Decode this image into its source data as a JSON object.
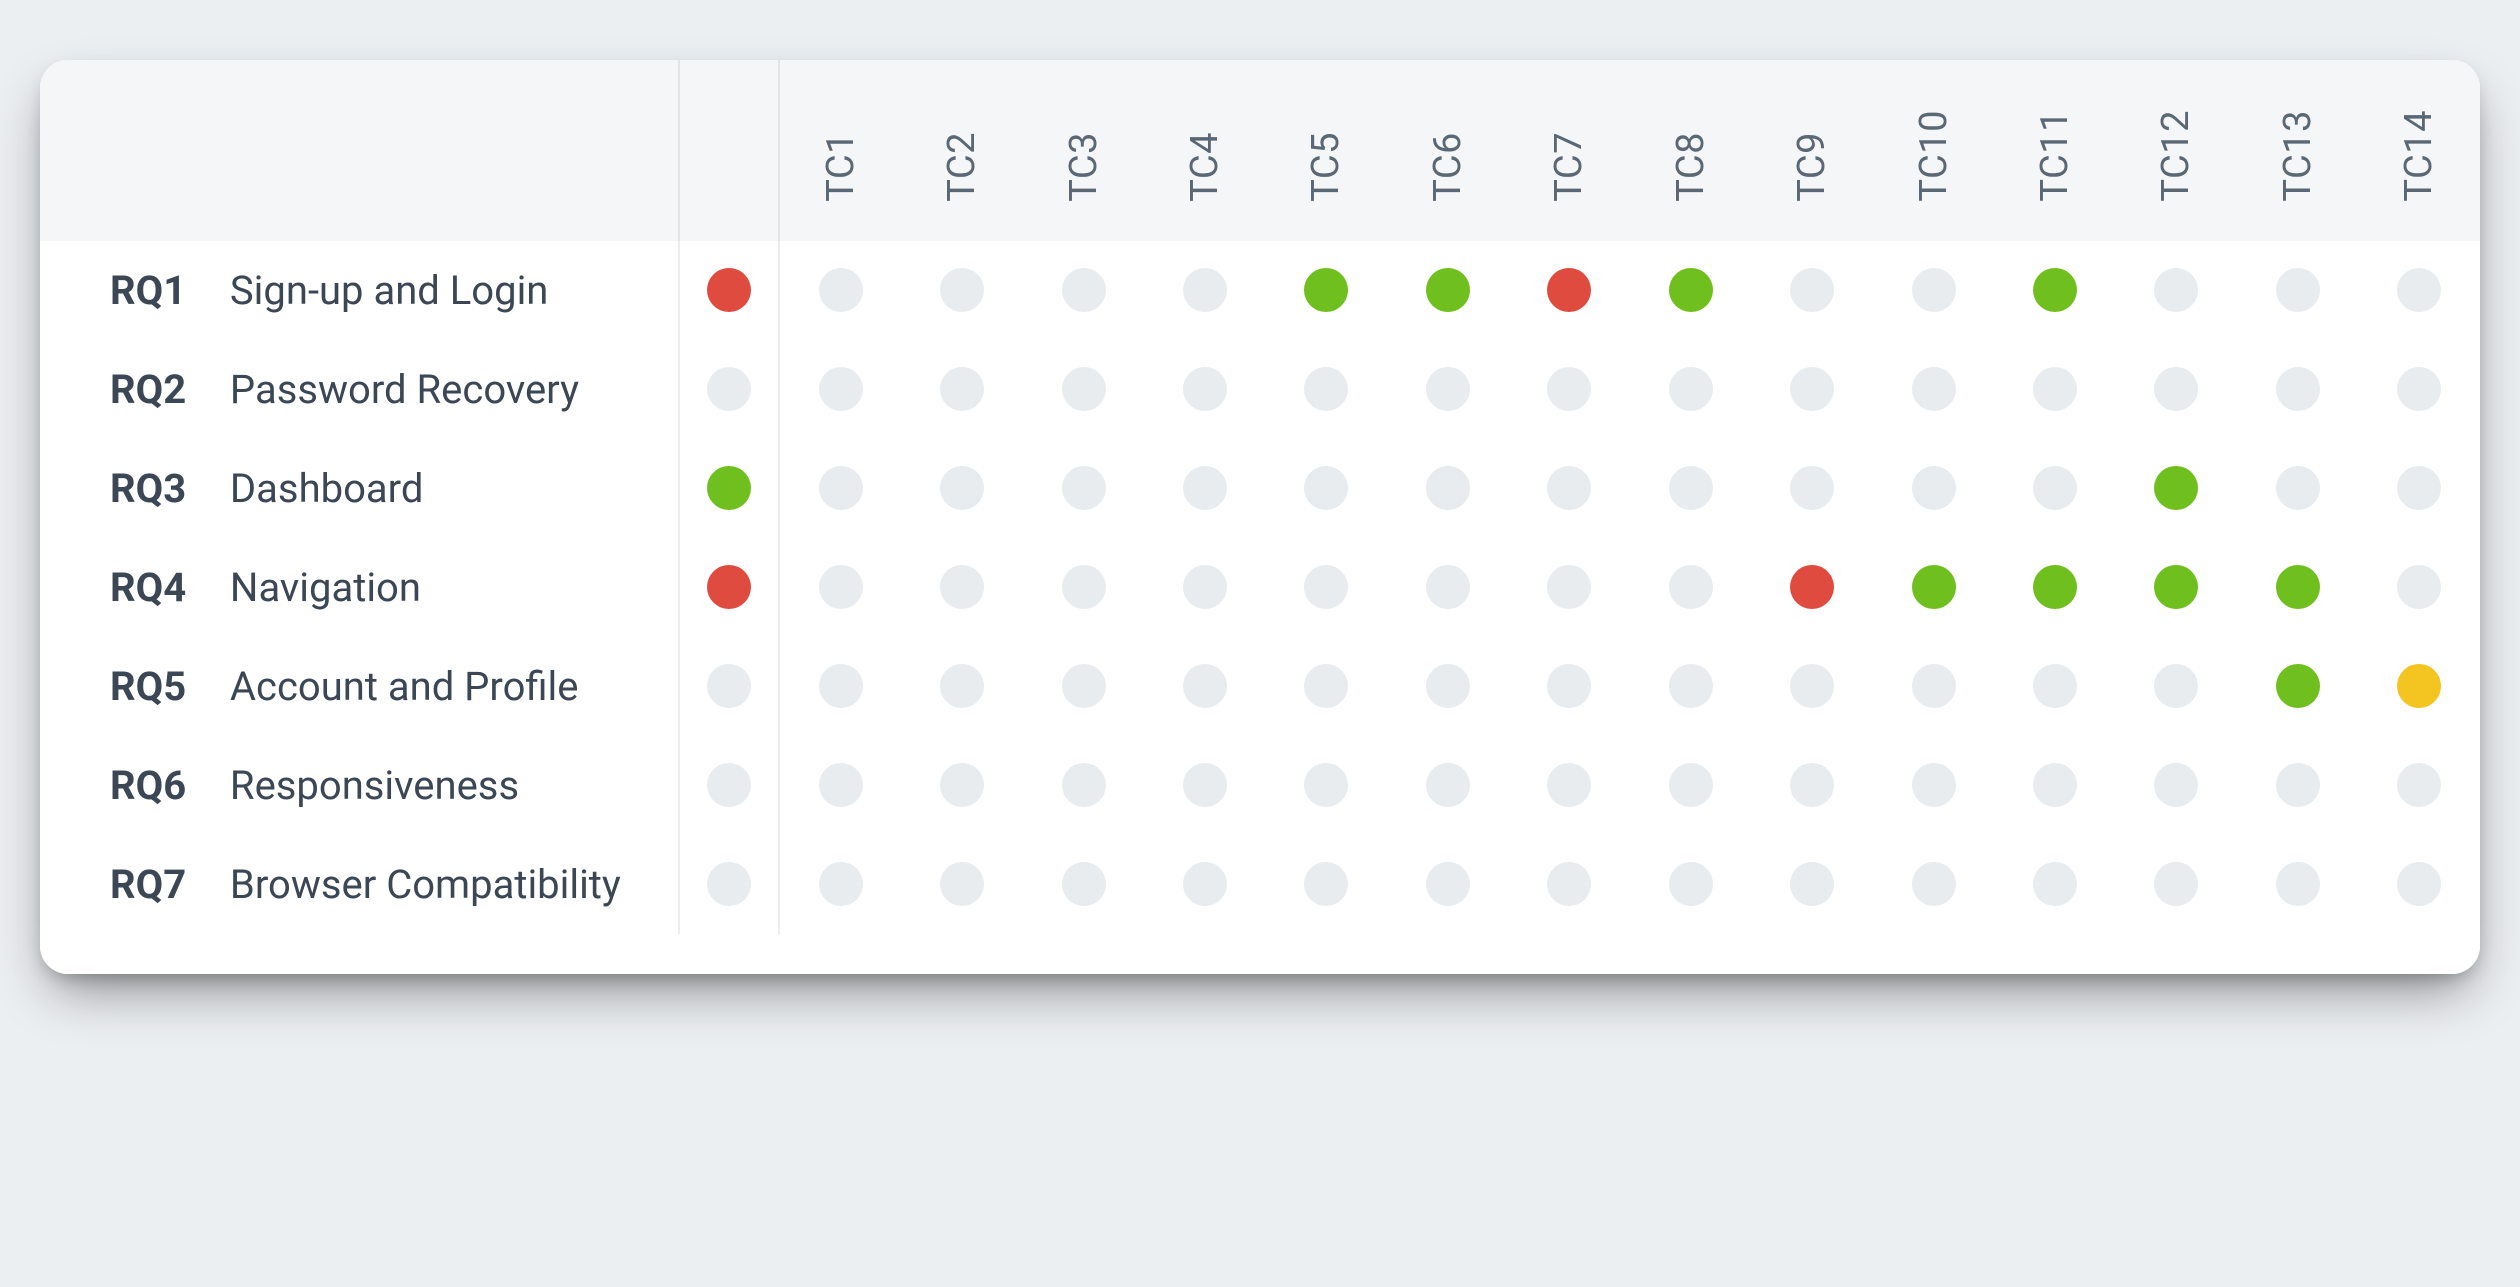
{
  "colors": {
    "green": "#6fbf1e",
    "red": "#e04b3f",
    "yellow": "#f4c420",
    "empty": "#e8ecef"
  },
  "testcases": [
    "TC1",
    "TC2",
    "TC3",
    "TC4",
    "TC5",
    "TC6",
    "TC7",
    "TC8",
    "TC9",
    "TC10",
    "TC11",
    "TC12",
    "TC13",
    "TC14"
  ],
  "requirements": [
    {
      "id": "RQ1",
      "name": "Sign-up and Login",
      "status": "red",
      "cells": [
        "",
        "",
        "",
        "",
        "green",
        "green",
        "red",
        "green",
        "",
        "",
        "green",
        "",
        "",
        ""
      ]
    },
    {
      "id": "RQ2",
      "name": "Password Recovery",
      "status": "",
      "cells": [
        "",
        "",
        "",
        "",
        "",
        "",
        "",
        "",
        "",
        "",
        "",
        "",
        "",
        ""
      ]
    },
    {
      "id": "RQ3",
      "name": "Dashboard",
      "status": "green",
      "cells": [
        "",
        "",
        "",
        "",
        "",
        "",
        "",
        "",
        "",
        "",
        "",
        "green",
        "",
        ""
      ]
    },
    {
      "id": "RQ4",
      "name": "Navigation",
      "status": "red",
      "cells": [
        "",
        "",
        "",
        "",
        "",
        "",
        "",
        "",
        "red",
        "green",
        "green",
        "green",
        "green",
        ""
      ]
    },
    {
      "id": "RQ5",
      "name": "Account and Profile",
      "status": "",
      "cells": [
        "",
        "",
        "",
        "",
        "",
        "",
        "",
        "",
        "",
        "",
        "",
        "",
        "green",
        "yellow"
      ]
    },
    {
      "id": "RQ6",
      "name": "Responsiveness",
      "status": "",
      "cells": [
        "",
        "",
        "",
        "",
        "",
        "",
        "",
        "",
        "",
        "",
        "",
        "",
        "",
        ""
      ]
    },
    {
      "id": "RQ7",
      "name": "Browser Compatibility",
      "status": "",
      "cells": [
        "",
        "",
        "",
        "",
        "",
        "",
        "",
        "",
        "",
        "",
        "",
        "",
        "",
        ""
      ]
    }
  ]
}
